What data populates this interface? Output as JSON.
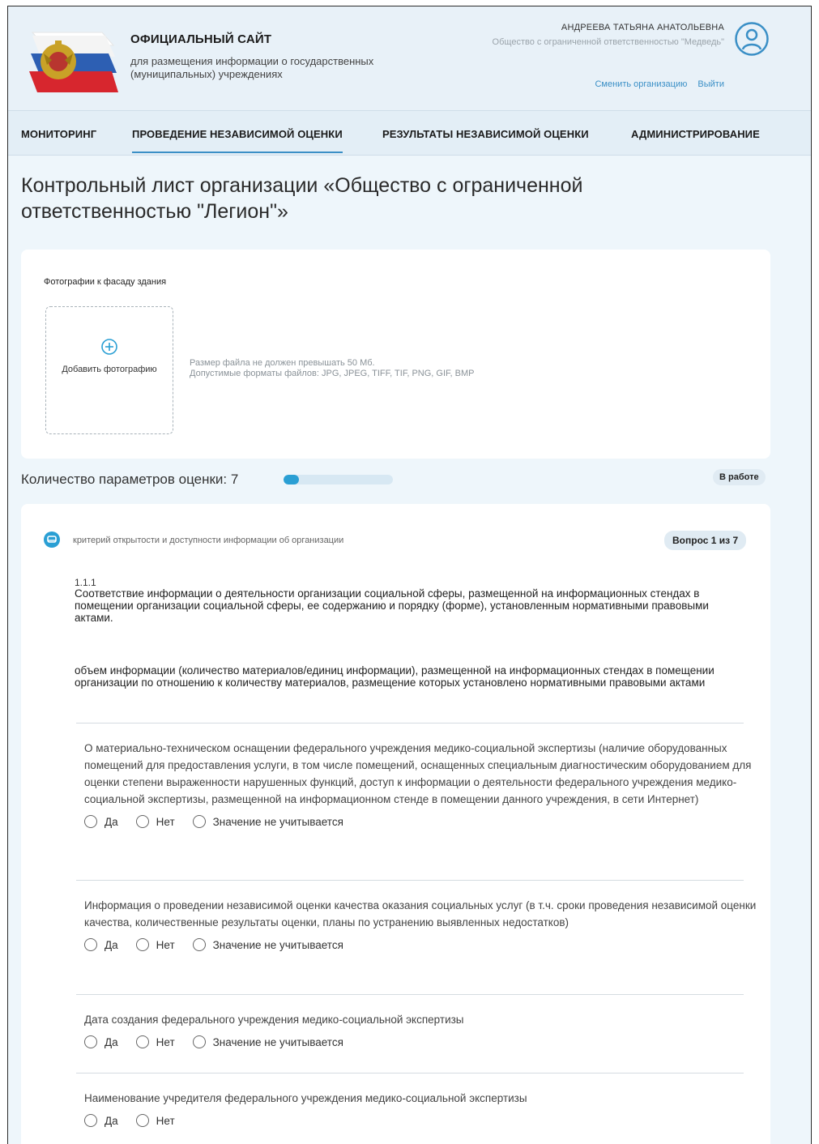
{
  "header": {
    "site_title": "ОФИЦИАЛЬНЫЙ САЙТ",
    "site_subtitle": "для размещения информации о государственных (муниципальных) учреждениях",
    "user_name": "АНДРЕЕВА ТАТЬЯНА АНАТОЛЬЕВНА",
    "user_org": "Общество с ограниченной ответственностью \"Медведь\"",
    "change_org": "Сменить организацию",
    "logout": "Выйти"
  },
  "nav": {
    "items": [
      {
        "label": "МОНИТОРИНГ"
      },
      {
        "label": "ПРОВЕДЕНИЕ НЕЗАВИСИМОЙ ОЦЕНКИ"
      },
      {
        "label": "РЕЗУЛЬТАТЫ НЕЗАВИСИМОЙ ОЦЕНКИ"
      },
      {
        "label": "АДМИНИСТРИРОВАНИЕ"
      }
    ],
    "active": "ПРОВЕДЕНИЕ НЕЗАВИСИМОЙ ОЦЕНКИ"
  },
  "page": {
    "title": "Контрольный лист организации «Общество с ограниченной ответственностью \"Легион\"»"
  },
  "photos": {
    "label": "Фотографии к фасаду здания",
    "add_label": "Добавить фотографию",
    "size_note": "Размер файла не должен превышать 50 Мб.",
    "formats_note": "Допустимые форматы файлов: JPG, JPEG, TIFF, TIF, PNG, GIF, BMP"
  },
  "progress": {
    "label": "Количество параметров оценки: 7",
    "fraction": 0.14,
    "status": "В работе"
  },
  "question": {
    "criterion": "критерий открытости и доступности информации об организации",
    "badge": "Вопрос 1 из 7",
    "number": "1.1.1",
    "text": "Соответствие информации о деятельности организации социальной сферы, размещенной на информационных стендах в помещении организации социальной сферы, ее содержанию и порядку (форме), установленным нормативными правовыми актами.",
    "measure": "объем информации (количество материалов/единиц информации), размещенной на информационных стендах в помещении организации по отношению к количеству материалов, размещение которых установлено нормативными правовыми актами",
    "options": {
      "yes": "Да",
      "no": "Нет",
      "na": "Значение не учитывается"
    },
    "items": [
      {
        "text": "О материально-техническом оснащении федерального учреждения медико-социальной экспертизы (наличие оборудованных помещений для предоставления услуги, в том числе помещений, оснащенных специальным диагностическим оборудованием для оценки степени выраженности нарушенных функций, доступ к информации о деятельности федерального учреждения медико-социальной экспертизы, размещенной на информационном стенде в помещении данного учреждения, в сети Интернет)"
      },
      {
        "text": "Информация о проведении независимой оценки качества оказания социальных услуг (в т.ч. сроки проведения независимой оценки качества, количественные результаты оценки, планы по устранению выявленных недостатков)"
      },
      {
        "text": "Дата создания федерального учреждения медико-социальной экспертизы"
      },
      {
        "text": "Наименование учредителя федерального учреждения медико-социальной экспертизы"
      }
    ]
  },
  "colors": {
    "accent": "#3a8fc6",
    "progress": "#2a9fd4",
    "background": "#eef6fb"
  }
}
